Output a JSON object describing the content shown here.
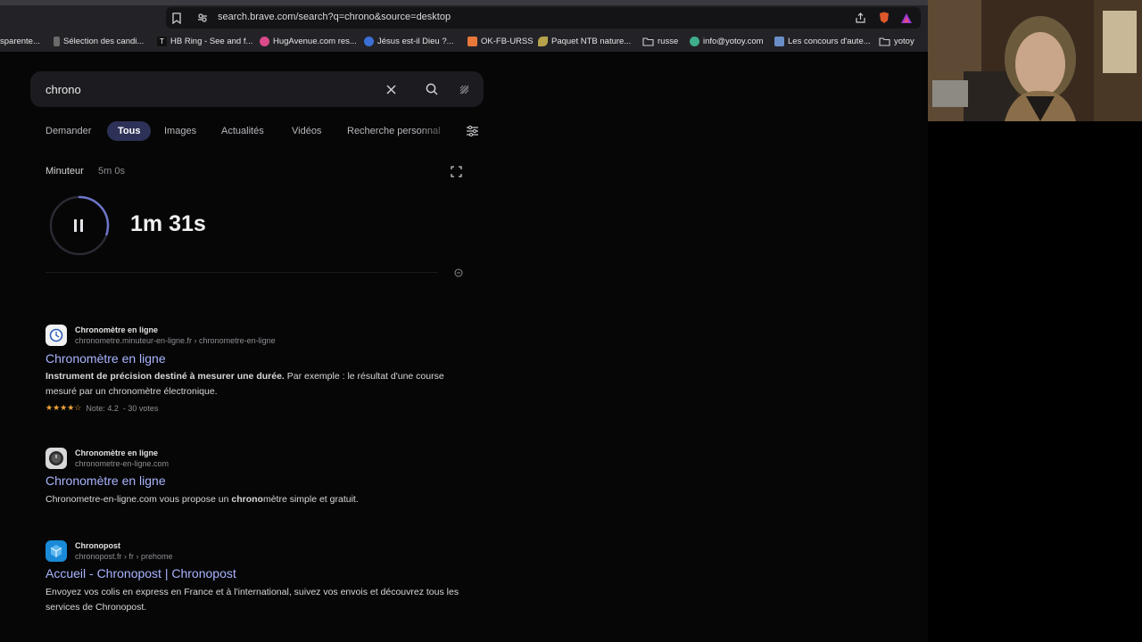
{
  "browser": {
    "url": "search.brave.com/search?q=chrono&source=desktop"
  },
  "bookmarks": [
    {
      "label": "sparente...",
      "color": "#5a5a5a"
    },
    {
      "label": "Sélection des candi...",
      "color": "#6a6a6a"
    },
    {
      "label": "HB Ring - See and f...",
      "color": "#111111"
    },
    {
      "label": "HugAvenue.com res...",
      "color": "#d94b8a"
    },
    {
      "label": "Jésus est-il Dieu ?...",
      "color": "#3b6fd6"
    },
    {
      "label": "OK-FB-URSS",
      "color": "#e8773a"
    },
    {
      "label": "Paquet NTB nature...",
      "color": "#b6a24a"
    },
    {
      "label": "russe",
      "color": "#c8c8c8"
    },
    {
      "label": "info@yotoy.com",
      "color": "#3fae8a"
    },
    {
      "label": "Les concours d'aute...",
      "color": "#6a8fc8"
    },
    {
      "label": "yotoy",
      "color": "#c8c8c8"
    }
  ],
  "search": {
    "query": "chrono"
  },
  "tabs": [
    {
      "label": "Demander",
      "active": false
    },
    {
      "label": "Tous",
      "active": true
    },
    {
      "label": "Images",
      "active": false
    },
    {
      "label": "Actualités",
      "active": false
    },
    {
      "label": "Vidéos",
      "active": false
    },
    {
      "label": "Recherche personnal",
      "active": false
    }
  ],
  "timer": {
    "label": "Minuteur",
    "total": "5m 0s",
    "remaining": "1m 31s",
    "progress_fraction": 0.3
  },
  "results": [
    {
      "site": "Chronomètre en ligne",
      "url": "chronometre.minuteur-en-ligne.fr › chronometre-en-ligne",
      "title": "Chronomètre en ligne",
      "desc_bold": "Instrument de précision destiné à mesurer une durée.",
      "desc_rest": " Par exemple : le résultat d'une course mesuré par un chronomètre électronique.",
      "rating": "Note: 4.2",
      "votes": "- 30 votes",
      "stars": 4.2
    },
    {
      "site": "Chronomètre en ligne",
      "url": "chronometre-en-ligne.com",
      "title": "Chronomètre en ligne",
      "desc_pre": "Chronometre-en-ligne.com vous propose un ",
      "desc_bold": "chrono",
      "desc_post": "mètre simple et gratuit."
    },
    {
      "site": "Chronopost",
      "url": "chronopost.fr › fr › prehome",
      "title": "Accueil - Chronopost | Chronopost",
      "desc": "Envoyez vos colis en express en France et à l'international, suivez vos envois et découvrez tous les services de Chronopost."
    }
  ],
  "colors": {
    "accent": "#2d3157",
    "link": "#a9b4ff",
    "ring": "#6d74c8"
  }
}
